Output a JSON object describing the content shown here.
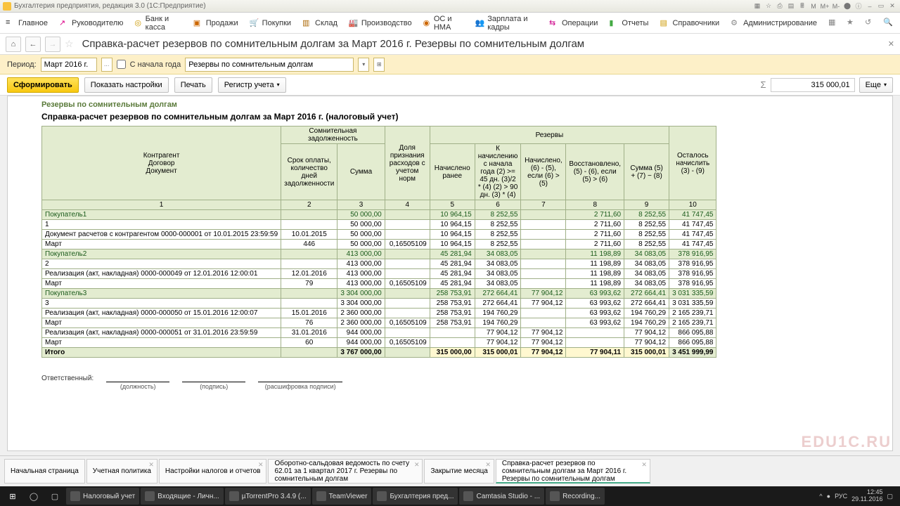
{
  "window": {
    "title": "Бухгалтерия предприятия, редакция 3.0  (1С:Предприятие)"
  },
  "menu": {
    "items": [
      "Главное",
      "Руководителю",
      "Банк и касса",
      "Продажи",
      "Покупки",
      "Склад",
      "Производство",
      "ОС и НМА",
      "Зарплата и кадры",
      "Операции",
      "Отчеты",
      "Справочники",
      "Администрирование"
    ]
  },
  "nav": {
    "title": "Справка-расчет резервов по сомнительным долгам за Март 2016 г. Резервы по сомнительным долгам"
  },
  "filter": {
    "period_label": "Период:",
    "period_value": "Март 2016 г.",
    "from_year_label": "С начала года",
    "report_type": "Резервы по сомнительным долгам"
  },
  "actions": {
    "generate": "Сформировать",
    "settings": "Показать настройки",
    "print": "Печать",
    "register": "Регистр учета",
    "more": "Еще",
    "sum_value": "315 000,01"
  },
  "report": {
    "title1": "Резервы по сомнительным долгам",
    "title2": "Справка-расчет резервов по сомнительным долгам за Март 2016 г. (налоговый учет)",
    "headers": {
      "h1": "Контрагент\nДоговор\nДокумент",
      "grp1": "Сомнительная задолженность",
      "h2": "Срок оплаты, количество дней задолженности",
      "h3": "Сумма",
      "h4": "Доля признания расходов с учетом норм",
      "grp2": "Резервы",
      "h5": "Начислено ранее",
      "h6": "К начислению с начала года (2) >= 45 дн. (3)/2 * (4)  (2) > 90 дн. (3) * (4)",
      "h7": "Начислено, (6) - (5), если (6) > (5)",
      "h8": "Восстановлено, (5) - (6), если (5) > (6)",
      "h9": "Сумма (5) + (7) − (8)",
      "h10": "Осталось начислить (3) - (9)"
    },
    "colnums": [
      "1",
      "2",
      "3",
      "4",
      "5",
      "6",
      "7",
      "8",
      "9",
      "10"
    ],
    "rows": [
      {
        "cls": "grp",
        "c": [
          "Покупатель1",
          "",
          "50 000,00",
          "",
          "10 964,15",
          "8 252,55",
          "",
          "2 711,60",
          "8 252,55",
          "41 747,45"
        ]
      },
      {
        "cls": "",
        "c": [
          "1",
          "",
          "50 000,00",
          "",
          "10 964,15",
          "8 252,55",
          "",
          "2 711,60",
          "8 252,55",
          "41 747,45"
        ]
      },
      {
        "cls": "",
        "c": [
          "Документ расчетов с контрагентом 0000-000001 от 10.01.2015 23:59:59",
          "10.01.2015",
          "50 000,00",
          "",
          "10 964,15",
          "8 252,55",
          "",
          "2 711,60",
          "8 252,55",
          "41 747,45"
        ]
      },
      {
        "cls": "",
        "c": [
          "Март",
          "446",
          "50 000,00",
          "0,16505109",
          "10 964,15",
          "8 252,55",
          "",
          "2 711,60",
          "8 252,55",
          "41 747,45"
        ]
      },
      {
        "cls": "grp",
        "c": [
          "Покупатель2",
          "",
          "413 000,00",
          "",
          "45 281,94",
          "34 083,05",
          "",
          "11 198,89",
          "34 083,05",
          "378 916,95"
        ]
      },
      {
        "cls": "",
        "c": [
          "2",
          "",
          "413 000,00",
          "",
          "45 281,94",
          "34 083,05",
          "",
          "11 198,89",
          "34 083,05",
          "378 916,95"
        ]
      },
      {
        "cls": "",
        "c": [
          "Реализация (акт, накладная) 0000-000049 от 12.01.2016 12:00:01",
          "12.01.2016",
          "413 000,00",
          "",
          "45 281,94",
          "34 083,05",
          "",
          "11 198,89",
          "34 083,05",
          "378 916,95"
        ]
      },
      {
        "cls": "",
        "c": [
          "Март",
          "79",
          "413 000,00",
          "0,16505109",
          "45 281,94",
          "34 083,05",
          "",
          "11 198,89",
          "34 083,05",
          "378 916,95"
        ]
      },
      {
        "cls": "grp",
        "c": [
          "Покупатель3",
          "",
          "3 304 000,00",
          "",
          "258 753,91",
          "272 664,41",
          "77 904,12",
          "63 993,62",
          "272 664,41",
          "3 031 335,59"
        ]
      },
      {
        "cls": "",
        "c": [
          "3",
          "",
          "3 304 000,00",
          "",
          "258 753,91",
          "272 664,41",
          "77 904,12",
          "63 993,62",
          "272 664,41",
          "3 031 335,59"
        ]
      },
      {
        "cls": "",
        "c": [
          "Реализация (акт, накладная) 0000-000050 от 15.01.2016 12:00:07",
          "15.01.2016",
          "2 360 000,00",
          "",
          "258 753,91",
          "194 760,29",
          "",
          "63 993,62",
          "194 760,29",
          "2 165 239,71"
        ]
      },
      {
        "cls": "",
        "c": [
          "Март",
          "76",
          "2 360 000,00",
          "0,16505109",
          "258 753,91",
          "194 760,29",
          "",
          "63 993,62",
          "194 760,29",
          "2 165 239,71"
        ]
      },
      {
        "cls": "",
        "c": [
          "Реализация (акт, накладная) 0000-000051 от 31.01.2016 23:59:59",
          "31.01.2016",
          "944 000,00",
          "",
          "",
          "77 904,12",
          "77 904,12",
          "",
          "77 904,12",
          "866 095,88"
        ]
      },
      {
        "cls": "",
        "c": [
          "Март",
          "60",
          "944 000,00",
          "0,16505109",
          "",
          "77 904,12",
          "77 904,12",
          "",
          "77 904,12",
          "866 095,88"
        ]
      }
    ],
    "total": {
      "label": "Итого",
      "c": [
        "",
        "3 767 000,00",
        "",
        "315 000,00",
        "315 000,01",
        "77 904,12",
        "77 904,11",
        "315 000,01",
        "3 451 999,99"
      ]
    },
    "sign": {
      "resp": "Ответственный:",
      "s1": "(должность)",
      "s2": "(подпись)",
      "s3": "(расшифровка подписи)"
    }
  },
  "tabs": [
    {
      "label": "Начальная страница",
      "active": false,
      "close": false
    },
    {
      "label": "Учетная политика",
      "active": false,
      "close": true
    },
    {
      "label": "Настройки налогов и отчетов",
      "active": false,
      "close": true
    },
    {
      "label": "Оборотно-сальдовая ведомость по счету 62.01 за 1 квартал 2017 г. Резервы по сомнительным долгам",
      "active": false,
      "close": true
    },
    {
      "label": "Закрытие месяца",
      "active": false,
      "close": true
    },
    {
      "label": "Справка-расчет резервов по сомнительным долгам за Март 2016 г. Резервы по сомнительным долгам",
      "active": true,
      "close": true
    }
  ],
  "taskbar": {
    "items": [
      "Налоговый учет",
      "Входящие - Личн...",
      "µTorrentPro 3.4.9 (...",
      "TeamViewer",
      "Бухгалтерия пред...",
      "Camtasia Studio - ...",
      "Recording..."
    ],
    "lang": "РУС",
    "clock": {
      "time": "12:45",
      "date": "29.11.2016"
    }
  },
  "watermark": "EDU1C.RU"
}
